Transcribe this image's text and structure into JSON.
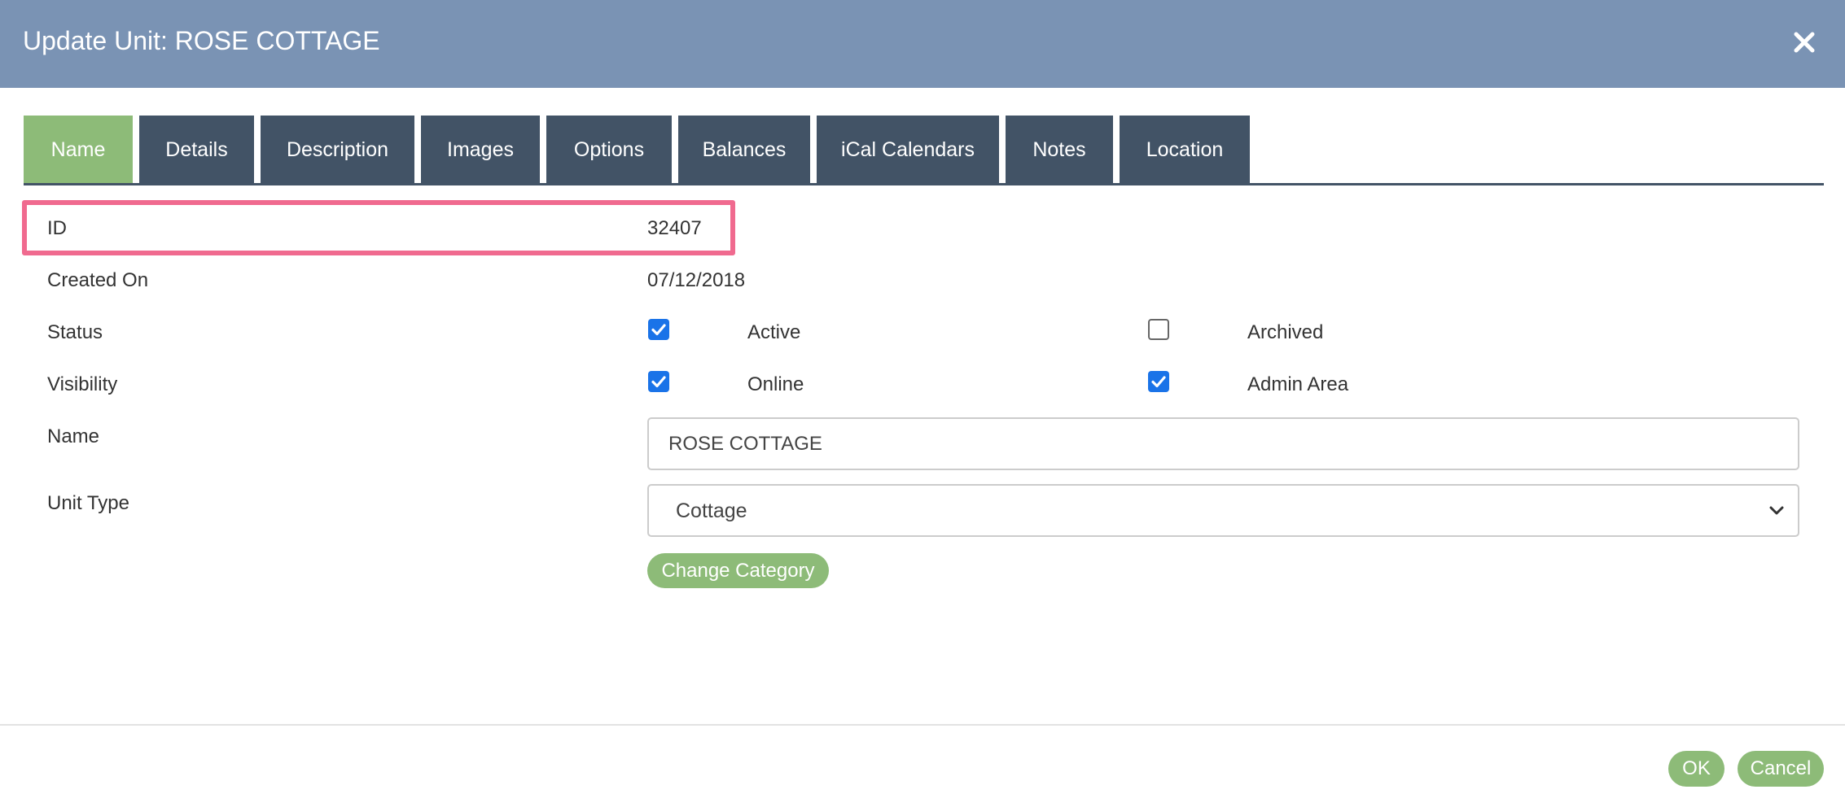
{
  "dialog": {
    "title": "Update Unit: ROSE COTTAGE",
    "close_icon": "close-icon"
  },
  "tabs": [
    {
      "label": "Name",
      "active": true
    },
    {
      "label": "Details",
      "active": false
    },
    {
      "label": "Description",
      "active": false
    },
    {
      "label": "Images",
      "active": false
    },
    {
      "label": "Options",
      "active": false
    },
    {
      "label": "Balances",
      "active": false
    },
    {
      "label": "iCal Calendars",
      "active": false
    },
    {
      "label": "Notes",
      "active": false
    },
    {
      "label": "Location",
      "active": false
    }
  ],
  "fields": {
    "id": {
      "label": "ID",
      "value": "32407"
    },
    "created_on": {
      "label": "Created On",
      "value": "07/12/2018"
    },
    "status": {
      "label": "Status",
      "options": [
        {
          "label": "Active",
          "checked": true
        },
        {
          "label": "Archived",
          "checked": false
        }
      ]
    },
    "visibility": {
      "label": "Visibility",
      "options": [
        {
          "label": "Online",
          "checked": true
        },
        {
          "label": "Admin Area",
          "checked": true
        }
      ]
    },
    "name": {
      "label": "Name",
      "value": "ROSE COTTAGE"
    },
    "unit_type": {
      "label": "Unit Type",
      "selected": "Cottage"
    }
  },
  "buttons": {
    "change_category": "Change Category",
    "ok": "OK",
    "cancel": "Cancel"
  },
  "colors": {
    "header": "#7a93b4",
    "tab": "#425366",
    "tab_active": "#8dbb78",
    "accent_green": "#8dbb78",
    "highlight": "#f06a8f",
    "checkbox": "#1a73e8"
  }
}
